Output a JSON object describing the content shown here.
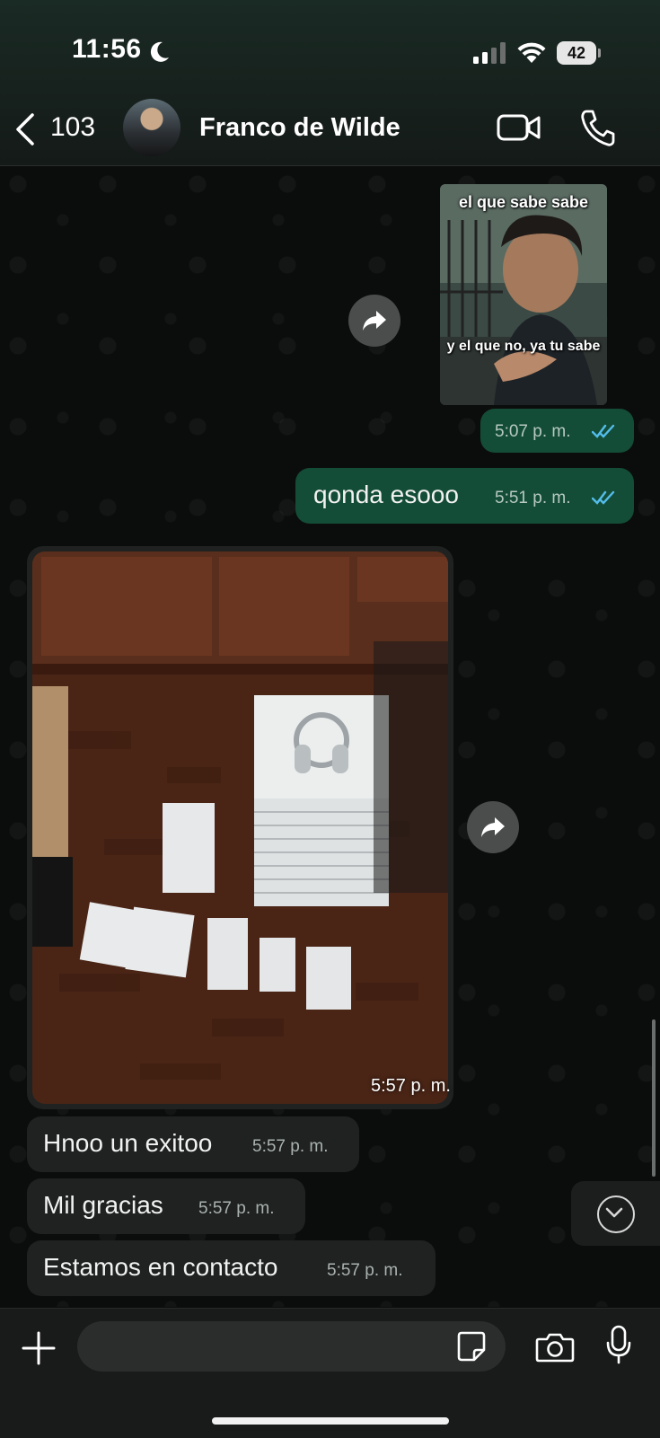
{
  "status_bar": {
    "time": "11:56",
    "battery": "42"
  },
  "header": {
    "back_count": "103",
    "contact_name": "Franco de Wilde"
  },
  "messages": [
    {
      "type": "image",
      "direction": "outgoing",
      "meme_top": "el que sabe sabe",
      "meme_bottom": "y el que no, ya tu sabe"
    },
    {
      "type": "time",
      "direction": "outgoing",
      "time": "5:07 p. m."
    },
    {
      "type": "text",
      "direction": "outgoing",
      "text": "qonda esooo",
      "time": "5:51 p. m."
    },
    {
      "type": "image",
      "direction": "incoming",
      "time": "5:57 p. m."
    },
    {
      "type": "text",
      "direction": "incoming",
      "text": "Hnoo un exitoo",
      "time": "5:57 p. m."
    },
    {
      "type": "text",
      "direction": "incoming",
      "text": "Mil gracias",
      "time": "5:57 p. m."
    },
    {
      "type": "text",
      "direction": "incoming",
      "text": "Estamos en contacto",
      "time": "5:57 p. m."
    }
  ],
  "composer": {
    "placeholder": ""
  },
  "colors": {
    "outgoing_bubble": "#144d37",
    "incoming_bubble": "#1f2221",
    "read_ticks": "#53bdeb"
  }
}
